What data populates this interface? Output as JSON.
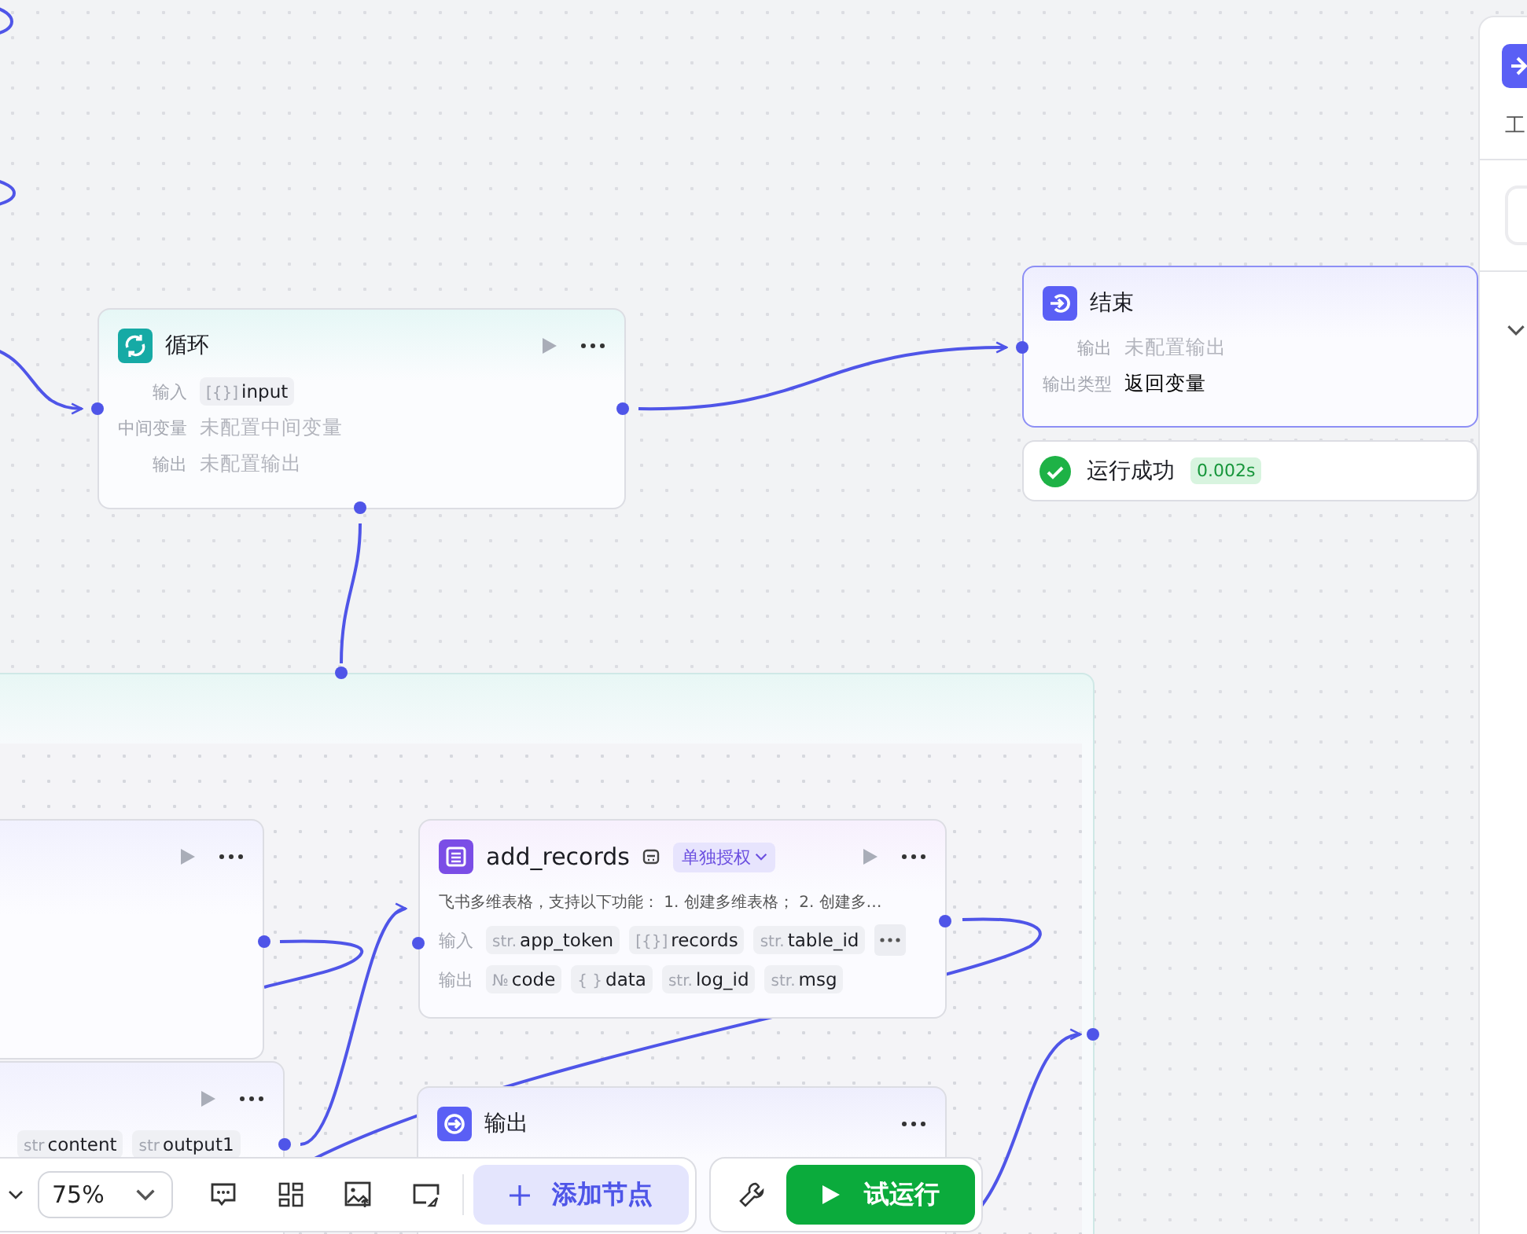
{
  "canvas": {
    "nodes": [
      {
        "kind": "loop",
        "title": "循环",
        "selected": false,
        "runnable": true,
        "rows": [
          {
            "label": "输入",
            "tags": [
              {
                "type": "[{}]",
                "name": "input"
              }
            ]
          },
          {
            "label": "中间变量",
            "value": "未配置中间变量",
            "muted": true
          },
          {
            "label": "输出",
            "value": "未配置输出",
            "muted": true
          }
        ]
      },
      {
        "kind": "end",
        "title": "结束",
        "selected": true,
        "runnable": false,
        "rows": [
          {
            "label": "输出",
            "value": "未配置输出",
            "muted": true
          },
          {
            "label": "输出类型",
            "value": "返回变量",
            "muted": false
          }
        ],
        "status": {
          "text": "运行成功",
          "time": "0.002s"
        }
      },
      {
        "kind": "blank",
        "selected": false,
        "runnable": true
      },
      {
        "kind": "blank",
        "selected": false,
        "runnable": true,
        "rows": [
          {
            "tags": [
              {
                "type": "str",
                "name": "content"
              },
              {
                "type": "str",
                "name": "output1"
              }
            ]
          }
        ]
      },
      {
        "kind": "plugin",
        "title": "add_records",
        "auth": "单独授权",
        "selected": false,
        "runnable": true,
        "description": "飞书多维表格，支持以下功能： 1. 创建多维表格； 2. 创建多…",
        "overflow": true,
        "rows": [
          {
            "label": "输入",
            "tags": [
              {
                "type": "str.",
                "name": "app_token"
              },
              {
                "type": "[{}]",
                "name": "records"
              },
              {
                "type": "str.",
                "name": "table_id"
              }
            ]
          },
          {
            "label": "输出",
            "tags": [
              {
                "type": "№",
                "name": "code"
              },
              {
                "type": "{ }",
                "name": "data"
              },
              {
                "type": "str.",
                "name": "log_id"
              },
              {
                "type": "str.",
                "name": "msg"
              }
            ]
          }
        ]
      },
      {
        "kind": "output",
        "title": "输出",
        "selected": false,
        "runnable": false
      }
    ]
  },
  "toolbar": {
    "zoom": "75%",
    "add_button": "添加节点",
    "run_button": "试运行"
  },
  "side_panel": {
    "subtitle": "工"
  }
}
